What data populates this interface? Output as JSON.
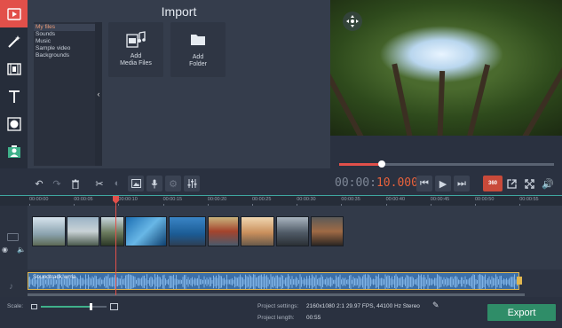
{
  "colors": {
    "accent": "#e2504a",
    "export": "#2f8d68",
    "timecode_accent": "#e8623c",
    "audio_border": "#e0b64f",
    "timeline_line": "#3fa7a0"
  },
  "rail": {
    "tools": [
      {
        "name": "video-import-icon",
        "active": true
      },
      {
        "name": "magic-wand-icon"
      },
      {
        "name": "film-strip-icon"
      },
      {
        "name": "text-icon"
      },
      {
        "name": "filter-icon"
      },
      {
        "name": "sticker-person-icon"
      }
    ]
  },
  "import": {
    "title": "Import",
    "categories": [
      "My files",
      "Sounds",
      "Music",
      "Sample video",
      "Backgrounds"
    ],
    "add_media": "Add\nMedia Files",
    "add_folder": "Add\nFolder",
    "add_media_l1": "Add",
    "add_media_l2": "Media Files",
    "add_folder_l1": "Add",
    "add_folder_l2": "Folder"
  },
  "preview": {
    "progress": 0.2,
    "compass": "move-icon"
  },
  "toolbar": {
    "timecode_main": "00:00:",
    "timecode_accent": "10.000",
    "icons": [
      "undo-icon",
      "redo-icon",
      "delete-icon",
      "cut-icon",
      "color-adjust-icon",
      "crop-icon",
      "mic-icon",
      "gear-icon",
      "equalizer-icon",
      "prev-icon",
      "play-icon",
      "next-icon",
      "360-icon",
      "export-frame-icon",
      "fullscreen-icon",
      "volume-icon"
    ],
    "badge_360": "360"
  },
  "ruler": {
    "ticks": [
      "00:00:00",
      "00:00:05",
      "00:00:10",
      "00:00:15",
      "00:00:20",
      "00:00:25",
      "00:00:30",
      "00:00:35",
      "00:00:40",
      "00:00:45",
      "00:00:50",
      "00:00:55"
    ]
  },
  "audio": {
    "label": "Soundtrack.wma"
  },
  "bottom": {
    "scale_label": "Scale:",
    "scale_value": 0.75,
    "settings_label": "Project settings:",
    "settings_value": "2160x1080 2:1 29.97 FPS, 44100 Hz Stereo",
    "length_label": "Project length:",
    "length_value": "00:55",
    "export_label": "Export"
  }
}
